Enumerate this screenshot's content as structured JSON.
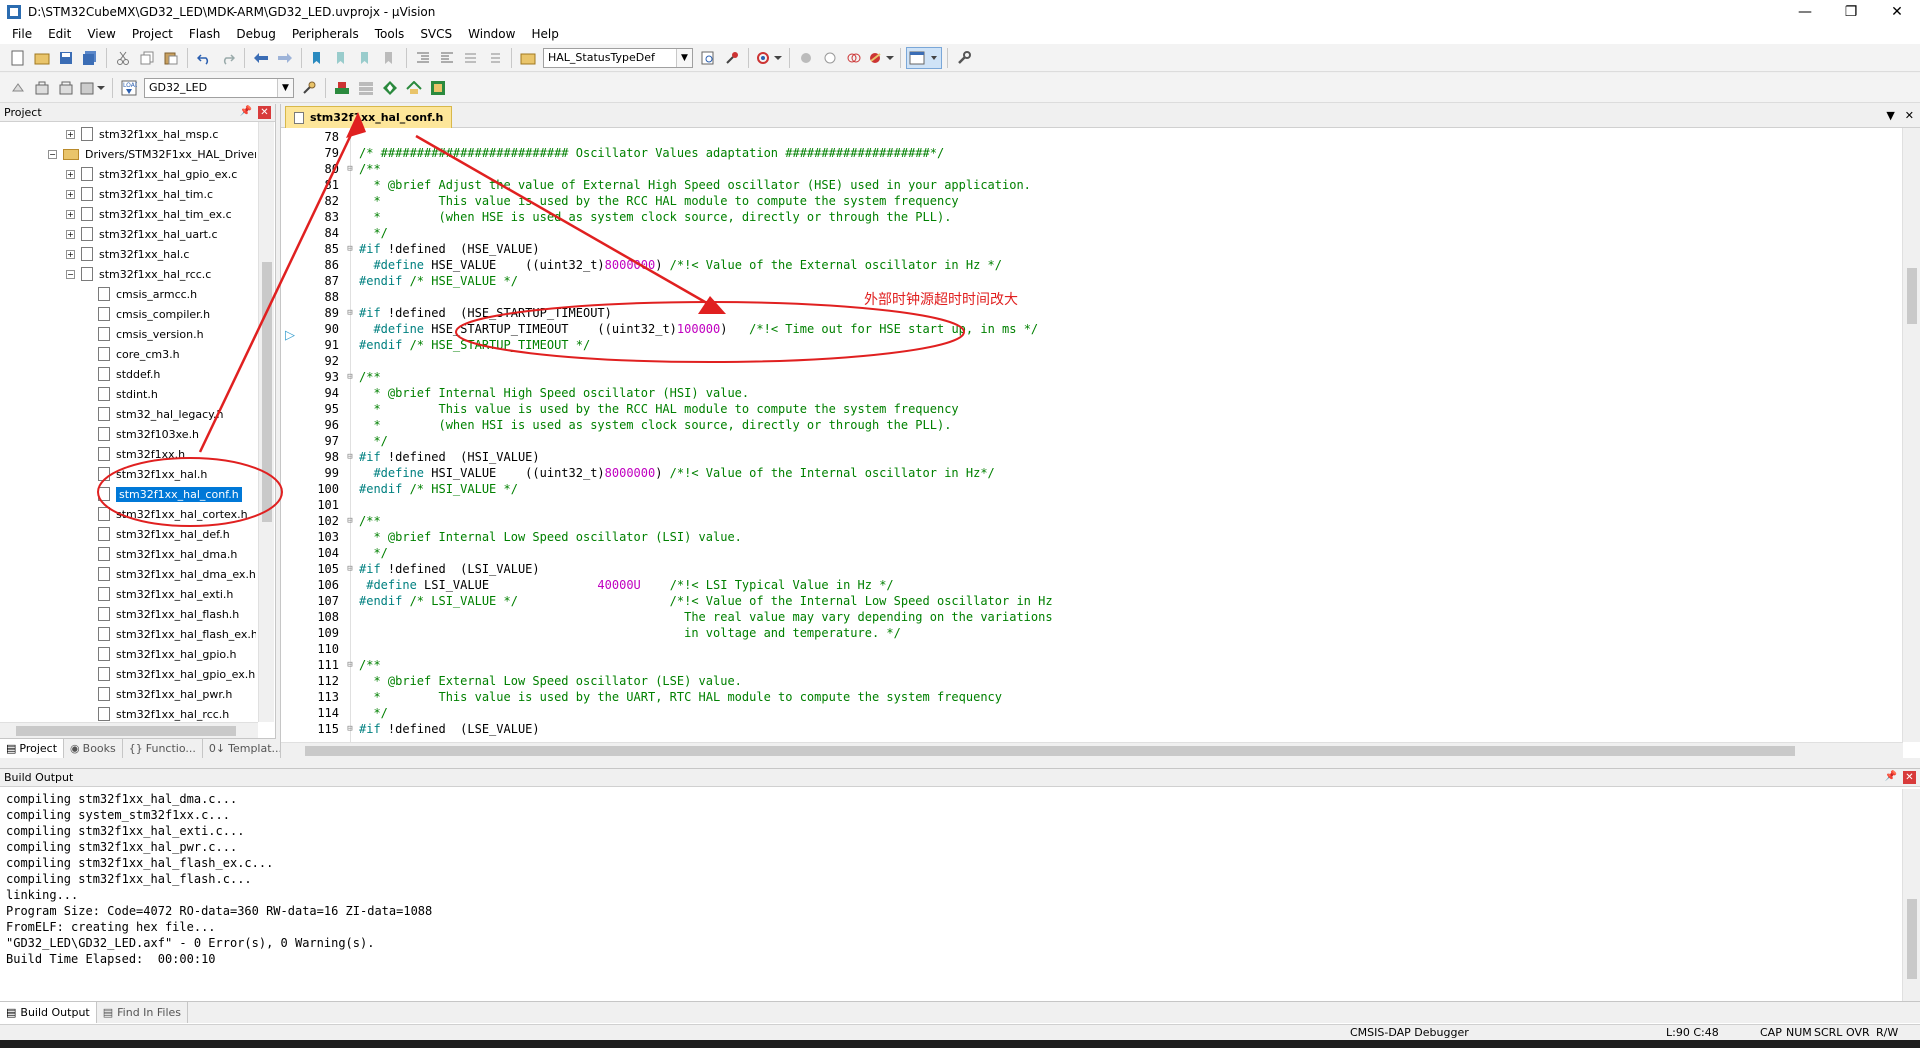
{
  "window": {
    "title": "D:\\STM32CubeMX\\GD32_LED\\MDK-ARM\\GD32_LED.uvprojx - µVision",
    "controls": [
      "—",
      "❐",
      "✕"
    ]
  },
  "menu": [
    "File",
    "Edit",
    "View",
    "Project",
    "Flash",
    "Debug",
    "Peripherals",
    "Tools",
    "SVCS",
    "Window",
    "Help"
  ],
  "toolbar": {
    "find_combo": "HAL_StatusTypeDef",
    "target_combo": "GD32_LED"
  },
  "project_panel": {
    "title": "Project",
    "tree": [
      {
        "label": "stm32f1xx_hal_msp.c",
        "level": 3,
        "type": "file-exp"
      },
      {
        "label": "Drivers/STM32F1xx_HAL_Driver",
        "level": 2,
        "type": "folder"
      },
      {
        "label": "stm32f1xx_hal_gpio_ex.c",
        "level": 3,
        "type": "file-exp"
      },
      {
        "label": "stm32f1xx_hal_tim.c",
        "level": 3,
        "type": "file-exp"
      },
      {
        "label": "stm32f1xx_hal_tim_ex.c",
        "level": 3,
        "type": "file-exp"
      },
      {
        "label": "stm32f1xx_hal_uart.c",
        "level": 3,
        "type": "file-exp"
      },
      {
        "label": "stm32f1xx_hal.c",
        "level": 3,
        "type": "file-exp"
      },
      {
        "label": "stm32f1xx_hal_rcc.c",
        "level": 3,
        "type": "file-open"
      },
      {
        "label": "cmsis_armcc.h",
        "level": 4,
        "type": "file"
      },
      {
        "label": "cmsis_compiler.h",
        "level": 4,
        "type": "file"
      },
      {
        "label": "cmsis_version.h",
        "level": 4,
        "type": "file"
      },
      {
        "label": "core_cm3.h",
        "level": 4,
        "type": "file"
      },
      {
        "label": "stddef.h",
        "level": 4,
        "type": "file"
      },
      {
        "label": "stdint.h",
        "level": 4,
        "type": "file"
      },
      {
        "label": "stm32_hal_legacy.h",
        "level": 4,
        "type": "file"
      },
      {
        "label": "stm32f103xe.h",
        "level": 4,
        "type": "file"
      },
      {
        "label": "stm32f1xx.h",
        "level": 4,
        "type": "file"
      },
      {
        "label": "stm32f1xx_hal.h",
        "level": 4,
        "type": "file"
      },
      {
        "label": "stm32f1xx_hal_conf.h",
        "level": 4,
        "type": "file",
        "selected": true
      },
      {
        "label": "stm32f1xx_hal_cortex.h",
        "level": 4,
        "type": "file"
      },
      {
        "label": "stm32f1xx_hal_def.h",
        "level": 4,
        "type": "file"
      },
      {
        "label": "stm32f1xx_hal_dma.h",
        "level": 4,
        "type": "file"
      },
      {
        "label": "stm32f1xx_hal_dma_ex.h",
        "level": 4,
        "type": "file"
      },
      {
        "label": "stm32f1xx_hal_exti.h",
        "level": 4,
        "type": "file"
      },
      {
        "label": "stm32f1xx_hal_flash.h",
        "level": 4,
        "type": "file"
      },
      {
        "label": "stm32f1xx_hal_flash_ex.h",
        "level": 4,
        "type": "file"
      },
      {
        "label": "stm32f1xx_hal_gpio.h",
        "level": 4,
        "type": "file"
      },
      {
        "label": "stm32f1xx_hal_gpio_ex.h",
        "level": 4,
        "type": "file"
      },
      {
        "label": "stm32f1xx_hal_pwr.h",
        "level": 4,
        "type": "file"
      },
      {
        "label": "stm32f1xx_hal_rcc.h",
        "level": 4,
        "type": "file"
      }
    ],
    "tabs": [
      "Project",
      "Books",
      "Functio...",
      "Templat..."
    ]
  },
  "editor": {
    "active_tab": "stm32f1xx_hal_conf.h",
    "lines": [
      {
        "n": "78",
        "fold": "",
        "segs": [
          [
            "",
            ""
          ]
        ]
      },
      {
        "n": "79",
        "fold": "",
        "segs": [
          [
            "c-comment",
            "/* ########################## Oscillator Values adaptation ####################*/"
          ]
        ]
      },
      {
        "n": "80",
        "fold": "⊟",
        "segs": [
          [
            "c-comment",
            "/**"
          ]
        ]
      },
      {
        "n": "81",
        "fold": "",
        "segs": [
          [
            "c-comment",
            "  * @brief Adjust the value of External High Speed oscillator (HSE) used in your application."
          ]
        ]
      },
      {
        "n": "82",
        "fold": "",
        "segs": [
          [
            "c-comment",
            "  *        This value is used by the RCC HAL module to compute the system frequency"
          ]
        ]
      },
      {
        "n": "83",
        "fold": "",
        "segs": [
          [
            "c-comment",
            "  *        (when HSE is used as system clock source, directly or through the PLL)."
          ]
        ]
      },
      {
        "n": "84",
        "fold": "",
        "segs": [
          [
            "c-comment",
            "  */"
          ]
        ]
      },
      {
        "n": "85",
        "fold": "⊟",
        "segs": [
          [
            "c-pre",
            "#if "
          ],
          [
            "",
            "!defined  (HSE_VALUE)"
          ]
        ]
      },
      {
        "n": "86",
        "fold": "",
        "segs": [
          [
            "c-pre",
            "  #define "
          ],
          [
            "",
            "HSE_VALUE    ((uint32_t)"
          ],
          [
            "c-num",
            "8000000"
          ],
          [
            "",
            ") "
          ],
          [
            "c-comment",
            "/*!< Value of the External oscillator in Hz */"
          ]
        ]
      },
      {
        "n": "87",
        "fold": "",
        "segs": [
          [
            "c-pre",
            "#endif "
          ],
          [
            "c-comment",
            "/* HSE_VALUE */"
          ]
        ]
      },
      {
        "n": "88",
        "fold": "",
        "segs": [
          [
            "",
            ""
          ]
        ]
      },
      {
        "n": "89",
        "fold": "⊟",
        "segs": [
          [
            "c-pre",
            "#if "
          ],
          [
            "",
            "!defined  (HSE_STARTUP_TIMEOUT)"
          ]
        ]
      },
      {
        "n": "90",
        "fold": "",
        "segs": [
          [
            "c-pre",
            "  #define "
          ],
          [
            "",
            "HSE_STARTUP_TIMEOUT    ((uint32_t)"
          ],
          [
            "c-num",
            "100000"
          ],
          [
            "",
            ")   "
          ],
          [
            "c-comment",
            "/*!< Time out for HSE start up, in ms */"
          ]
        ]
      },
      {
        "n": "91",
        "fold": "",
        "segs": [
          [
            "c-pre",
            "#endif "
          ],
          [
            "c-comment",
            "/* HSE_STARTUP_TIMEOUT */"
          ]
        ]
      },
      {
        "n": "92",
        "fold": "",
        "segs": [
          [
            "",
            ""
          ]
        ]
      },
      {
        "n": "93",
        "fold": "⊟",
        "segs": [
          [
            "c-comment",
            "/**"
          ]
        ]
      },
      {
        "n": "94",
        "fold": "",
        "segs": [
          [
            "c-comment",
            "  * @brief Internal High Speed oscillator (HSI) value."
          ]
        ]
      },
      {
        "n": "95",
        "fold": "",
        "segs": [
          [
            "c-comment",
            "  *        This value is used by the RCC HAL module to compute the system frequency"
          ]
        ]
      },
      {
        "n": "96",
        "fold": "",
        "segs": [
          [
            "c-comment",
            "  *        (when HSI is used as system clock source, directly or through the PLL)."
          ]
        ]
      },
      {
        "n": "97",
        "fold": "",
        "segs": [
          [
            "c-comment",
            "  */"
          ]
        ]
      },
      {
        "n": "98",
        "fold": "⊟",
        "segs": [
          [
            "c-pre",
            "#if "
          ],
          [
            "",
            "!defined  (HSI_VALUE)"
          ]
        ]
      },
      {
        "n": "99",
        "fold": "",
        "segs": [
          [
            "c-pre",
            "  #define "
          ],
          [
            "",
            "HSI_VALUE    ((uint32_t)"
          ],
          [
            "c-num",
            "8000000"
          ],
          [
            "",
            ") "
          ],
          [
            "c-comment",
            "/*!< Value of the Internal oscillator in Hz*/"
          ]
        ]
      },
      {
        "n": "100",
        "fold": "",
        "segs": [
          [
            "c-pre",
            "#endif "
          ],
          [
            "c-comment",
            "/* HSI_VALUE */"
          ]
        ]
      },
      {
        "n": "101",
        "fold": "",
        "segs": [
          [
            "",
            ""
          ]
        ]
      },
      {
        "n": "102",
        "fold": "⊟",
        "segs": [
          [
            "c-comment",
            "/**"
          ]
        ]
      },
      {
        "n": "103",
        "fold": "",
        "segs": [
          [
            "c-comment",
            "  * @brief Internal Low Speed oscillator (LSI) value."
          ]
        ]
      },
      {
        "n": "104",
        "fold": "",
        "segs": [
          [
            "c-comment",
            "  */"
          ]
        ]
      },
      {
        "n": "105",
        "fold": "⊟",
        "segs": [
          [
            "c-pre",
            "#if "
          ],
          [
            "",
            "!defined  (LSI_VALUE)"
          ]
        ]
      },
      {
        "n": "106",
        "fold": "",
        "segs": [
          [
            "c-pre",
            " #define "
          ],
          [
            "",
            "LSI_VALUE               "
          ],
          [
            "c-num",
            "40000U"
          ],
          [
            "",
            "    "
          ],
          [
            "c-comment",
            "/*!< LSI Typical Value in Hz */"
          ]
        ]
      },
      {
        "n": "107",
        "fold": "",
        "segs": [
          [
            "c-pre",
            "#endif "
          ],
          [
            "c-comment",
            "/* LSI_VALUE */                     /*!< Value of the Internal Low Speed oscillator in Hz"
          ]
        ]
      },
      {
        "n": "108",
        "fold": "",
        "segs": [
          [
            "c-comment",
            "                                             The real value may vary depending on the variations"
          ]
        ]
      },
      {
        "n": "109",
        "fold": "",
        "segs": [
          [
            "c-comment",
            "                                             in voltage and temperature. */"
          ]
        ]
      },
      {
        "n": "110",
        "fold": "",
        "segs": [
          [
            "",
            ""
          ]
        ]
      },
      {
        "n": "111",
        "fold": "⊟",
        "segs": [
          [
            "c-comment",
            "/**"
          ]
        ]
      },
      {
        "n": "112",
        "fold": "",
        "segs": [
          [
            "c-comment",
            "  * @brief External Low Speed oscillator (LSE) value."
          ]
        ]
      },
      {
        "n": "113",
        "fold": "",
        "segs": [
          [
            "c-comment",
            "  *        This value is used by the UART, RTC HAL module to compute the system frequency"
          ]
        ]
      },
      {
        "n": "114",
        "fold": "",
        "segs": [
          [
            "c-comment",
            "  */"
          ]
        ]
      },
      {
        "n": "115",
        "fold": "⊟",
        "segs": [
          [
            "c-pre",
            "#if "
          ],
          [
            "",
            "!defined  (LSE_VALUE)"
          ]
        ]
      }
    ]
  },
  "annotation": {
    "label": "外部时钟源超时时间改大",
    "color": "#e02020"
  },
  "build_output": {
    "title": "Build Output",
    "lines": [
      "compiling stm32f1xx_hal_dma.c...",
      "compiling system_stm32f1xx.c...",
      "compiling stm32f1xx_hal_exti.c...",
      "compiling stm32f1xx_hal_pwr.c...",
      "compiling stm32f1xx_hal_flash_ex.c...",
      "compiling stm32f1xx_hal_flash.c...",
      "linking...",
      "Program Size: Code=4072 RO-data=360 RW-data=16 ZI-data=1088",
      "FromELF: creating hex file...",
      "\"GD32_LED\\GD32_LED.axf\" - 0 Error(s), 0 Warning(s).",
      "Build Time Elapsed:  00:00:10"
    ],
    "tabs": [
      "Build Output",
      "Find In Files"
    ]
  },
  "status": {
    "debugger": "CMSIS-DAP Debugger",
    "position": "L:90 C:48",
    "caps": "CAP",
    "num": "NUM",
    "scrl": "SCRL",
    "ovr": "OVR",
    "rw": "R/W"
  }
}
